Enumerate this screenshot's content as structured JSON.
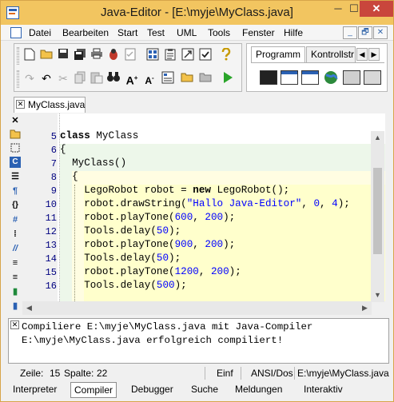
{
  "window": {
    "title": "Java-Editor - [E:\\myje\\MyClass.java]",
    "minimize": "─",
    "maximize": "☐",
    "close": "✕"
  },
  "menu": {
    "items": [
      "Datei",
      "Bearbeiten",
      "Start",
      "Test",
      "UML",
      "Tools",
      "Fenster",
      "Hilfe"
    ],
    "mdi_minimize": "_",
    "mdi_restore": "🗗",
    "mdi_close": "✕"
  },
  "toolbar": {
    "row1_icons": [
      "new-file",
      "open-folder",
      "save",
      "save-all",
      "print",
      "bug",
      "checklist",
      "gallery",
      "clipboard",
      "export",
      "checkbox",
      "help"
    ],
    "row2_icons": [
      "redo",
      "undo",
      "cut",
      "copy",
      "paste",
      "binoculars",
      "font-size-up",
      "font-size-down",
      "dictionary",
      "folder-yellow",
      "folder-grey",
      "run"
    ]
  },
  "palette": {
    "tabs": [
      "Programm",
      "Kontrollstr"
    ],
    "active_tab": "Programm",
    "arrow_left": "◀",
    "arrow_right": "▶",
    "components": [
      "console-window",
      "frame-window",
      "dialog-window",
      "applet-globe",
      "panel",
      "panel-alt"
    ]
  },
  "file_tab": {
    "label": "MyClass.java",
    "close": "✕"
  },
  "left_tools": [
    "✕",
    "📁",
    "◻",
    "C",
    "☰",
    "¶",
    "{}",
    "#",
    "⁞",
    "//",
    "≡",
    "≡",
    "▮",
    "▮"
  ],
  "editor": {
    "lines": [
      {
        "no": "5",
        "text": "class MyClass"
      },
      {
        "no": "6",
        "text": "{"
      },
      {
        "no": "7",
        "text": "  MyClass()"
      },
      {
        "no": "8",
        "text": "  {"
      },
      {
        "no": "9",
        "text": "    LegoRobot robot = new LegoRobot();"
      },
      {
        "no": "10",
        "text": "    robot.drawString(\"Hallo Java-Editor\", 0, 4);"
      },
      {
        "no": "11",
        "text": "    robot.playTone(600, 200);"
      },
      {
        "no": "12",
        "text": "    Tools.delay(50);"
      },
      {
        "no": "13",
        "text": "    robot.playTone(900, 200);"
      },
      {
        "no": "14",
        "text": "    Tools.delay(50);"
      },
      {
        "no": "15",
        "text": "    robot.playTone(1200, 200);"
      },
      {
        "no": "16",
        "text": "    Tools.delay(500);"
      }
    ]
  },
  "scroll": {
    "up": "▲",
    "down": "▼",
    "left": "◀",
    "right": "▶"
  },
  "messages": {
    "close": "✕",
    "lines": [
      "Compiliere E:\\myje\\MyClass.java mit Java-Compiler",
      "E:\\myje\\MyClass.java erfolgreich compiliert!"
    ]
  },
  "status": {
    "line_label": "Zeile:",
    "line_value": "15",
    "col_label": "Spalte:",
    "col_value": "22",
    "mode": "Einf",
    "encoding": "ANSI/Dos",
    "path": "E:\\myje\\MyClass.java"
  },
  "bottom_tabs": [
    "Interpreter",
    "Compiler",
    "Debugger",
    "Suche",
    "Meldungen",
    "Interaktiv"
  ],
  "bottom_active": "Compiler",
  "colors": {
    "titlebar": "#f2c560",
    "keyword": "#000000",
    "number": "#0000ff",
    "string": "#0000ff",
    "class_scope": "#edf7ea",
    "method_scope": "#fffde2",
    "body_scope": "#ffffcc",
    "line_numbers": "#000080"
  }
}
